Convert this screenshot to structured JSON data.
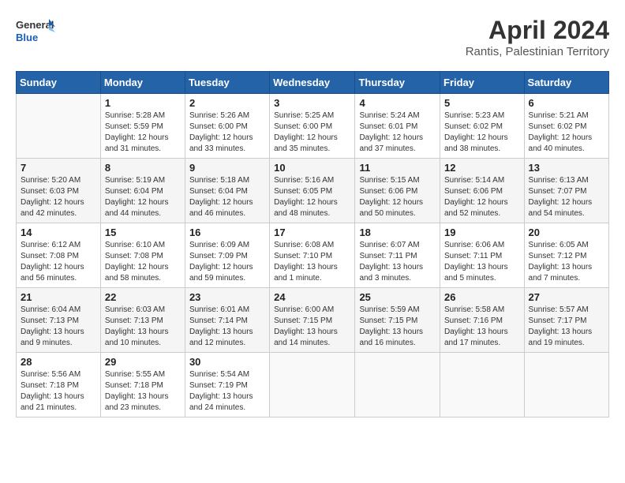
{
  "header": {
    "logo_line1": "General",
    "logo_line2": "Blue",
    "title": "April 2024",
    "subtitle": "Rantis, Palestinian Territory"
  },
  "calendar": {
    "days_of_week": [
      "Sunday",
      "Monday",
      "Tuesday",
      "Wednesday",
      "Thursday",
      "Friday",
      "Saturday"
    ],
    "weeks": [
      [
        {
          "day": "",
          "info": ""
        },
        {
          "day": "1",
          "info": "Sunrise: 5:28 AM\nSunset: 5:59 PM\nDaylight: 12 hours\nand 31 minutes."
        },
        {
          "day": "2",
          "info": "Sunrise: 5:26 AM\nSunset: 6:00 PM\nDaylight: 12 hours\nand 33 minutes."
        },
        {
          "day": "3",
          "info": "Sunrise: 5:25 AM\nSunset: 6:00 PM\nDaylight: 12 hours\nand 35 minutes."
        },
        {
          "day": "4",
          "info": "Sunrise: 5:24 AM\nSunset: 6:01 PM\nDaylight: 12 hours\nand 37 minutes."
        },
        {
          "day": "5",
          "info": "Sunrise: 5:23 AM\nSunset: 6:02 PM\nDaylight: 12 hours\nand 38 minutes."
        },
        {
          "day": "6",
          "info": "Sunrise: 5:21 AM\nSunset: 6:02 PM\nDaylight: 12 hours\nand 40 minutes."
        }
      ],
      [
        {
          "day": "7",
          "info": "Sunrise: 5:20 AM\nSunset: 6:03 PM\nDaylight: 12 hours\nand 42 minutes."
        },
        {
          "day": "8",
          "info": "Sunrise: 5:19 AM\nSunset: 6:04 PM\nDaylight: 12 hours\nand 44 minutes."
        },
        {
          "day": "9",
          "info": "Sunrise: 5:18 AM\nSunset: 6:04 PM\nDaylight: 12 hours\nand 46 minutes."
        },
        {
          "day": "10",
          "info": "Sunrise: 5:16 AM\nSunset: 6:05 PM\nDaylight: 12 hours\nand 48 minutes."
        },
        {
          "day": "11",
          "info": "Sunrise: 5:15 AM\nSunset: 6:06 PM\nDaylight: 12 hours\nand 50 minutes."
        },
        {
          "day": "12",
          "info": "Sunrise: 5:14 AM\nSunset: 6:06 PM\nDaylight: 12 hours\nand 52 minutes."
        },
        {
          "day": "13",
          "info": "Sunrise: 6:13 AM\nSunset: 7:07 PM\nDaylight: 12 hours\nand 54 minutes."
        }
      ],
      [
        {
          "day": "14",
          "info": "Sunrise: 6:12 AM\nSunset: 7:08 PM\nDaylight: 12 hours\nand 56 minutes."
        },
        {
          "day": "15",
          "info": "Sunrise: 6:10 AM\nSunset: 7:08 PM\nDaylight: 12 hours\nand 58 minutes."
        },
        {
          "day": "16",
          "info": "Sunrise: 6:09 AM\nSunset: 7:09 PM\nDaylight: 12 hours\nand 59 minutes."
        },
        {
          "day": "17",
          "info": "Sunrise: 6:08 AM\nSunset: 7:10 PM\nDaylight: 13 hours\nand 1 minute."
        },
        {
          "day": "18",
          "info": "Sunrise: 6:07 AM\nSunset: 7:11 PM\nDaylight: 13 hours\nand 3 minutes."
        },
        {
          "day": "19",
          "info": "Sunrise: 6:06 AM\nSunset: 7:11 PM\nDaylight: 13 hours\nand 5 minutes."
        },
        {
          "day": "20",
          "info": "Sunrise: 6:05 AM\nSunset: 7:12 PM\nDaylight: 13 hours\nand 7 minutes."
        }
      ],
      [
        {
          "day": "21",
          "info": "Sunrise: 6:04 AM\nSunset: 7:13 PM\nDaylight: 13 hours\nand 9 minutes."
        },
        {
          "day": "22",
          "info": "Sunrise: 6:03 AM\nSunset: 7:13 PM\nDaylight: 13 hours\nand 10 minutes."
        },
        {
          "day": "23",
          "info": "Sunrise: 6:01 AM\nSunset: 7:14 PM\nDaylight: 13 hours\nand 12 minutes."
        },
        {
          "day": "24",
          "info": "Sunrise: 6:00 AM\nSunset: 7:15 PM\nDaylight: 13 hours\nand 14 minutes."
        },
        {
          "day": "25",
          "info": "Sunrise: 5:59 AM\nSunset: 7:15 PM\nDaylight: 13 hours\nand 16 minutes."
        },
        {
          "day": "26",
          "info": "Sunrise: 5:58 AM\nSunset: 7:16 PM\nDaylight: 13 hours\nand 17 minutes."
        },
        {
          "day": "27",
          "info": "Sunrise: 5:57 AM\nSunset: 7:17 PM\nDaylight: 13 hours\nand 19 minutes."
        }
      ],
      [
        {
          "day": "28",
          "info": "Sunrise: 5:56 AM\nSunset: 7:18 PM\nDaylight: 13 hours\nand 21 minutes."
        },
        {
          "day": "29",
          "info": "Sunrise: 5:55 AM\nSunset: 7:18 PM\nDaylight: 13 hours\nand 23 minutes."
        },
        {
          "day": "30",
          "info": "Sunrise: 5:54 AM\nSunset: 7:19 PM\nDaylight: 13 hours\nand 24 minutes."
        },
        {
          "day": "",
          "info": ""
        },
        {
          "day": "",
          "info": ""
        },
        {
          "day": "",
          "info": ""
        },
        {
          "day": "",
          "info": ""
        }
      ]
    ]
  }
}
